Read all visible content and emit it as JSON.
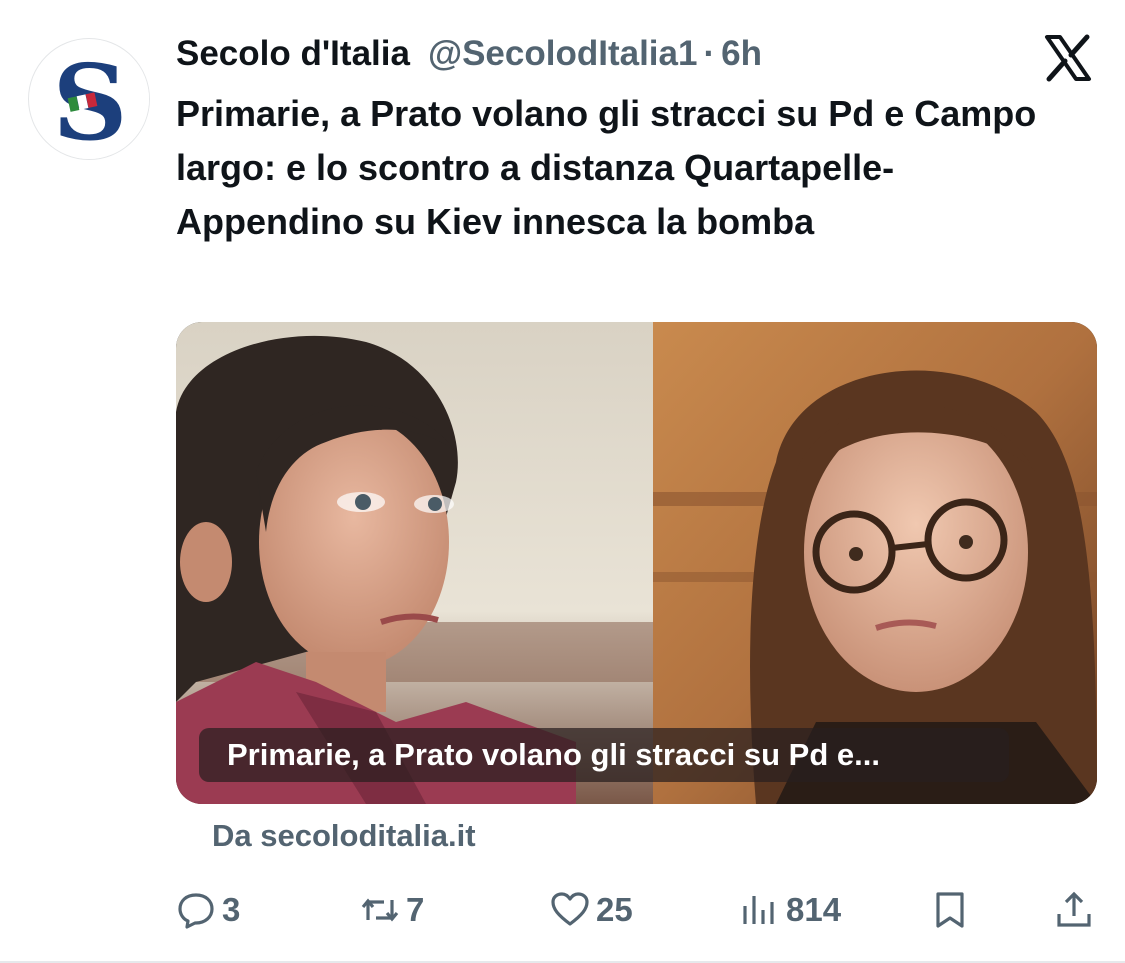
{
  "tweet": {
    "display_name": "Secolo d'Italia",
    "handle": "@SecolodItalia1",
    "separator": "·",
    "time": "6h",
    "headline": "Primarie, a Prato volano gli stracci su Pd e Campo largo: e lo scontro a distanza Quartapelle-Appendino su Kiev innesca la bomba",
    "avatar_icon": "secolo-ditalia-s-logo",
    "platform_icon": "x-logo-icon"
  },
  "link_card": {
    "caption": "Primarie, a Prato volano gli stracci su Pd e...",
    "source": "Da secoloditalia.it",
    "image": "two-women-portraits-split-photo"
  },
  "actions": {
    "replies": "3",
    "reposts": "7",
    "likes": "25",
    "views": "814"
  },
  "colors": {
    "text_primary": "#0f1419",
    "text_secondary": "#536471",
    "background": "#ffffff"
  }
}
